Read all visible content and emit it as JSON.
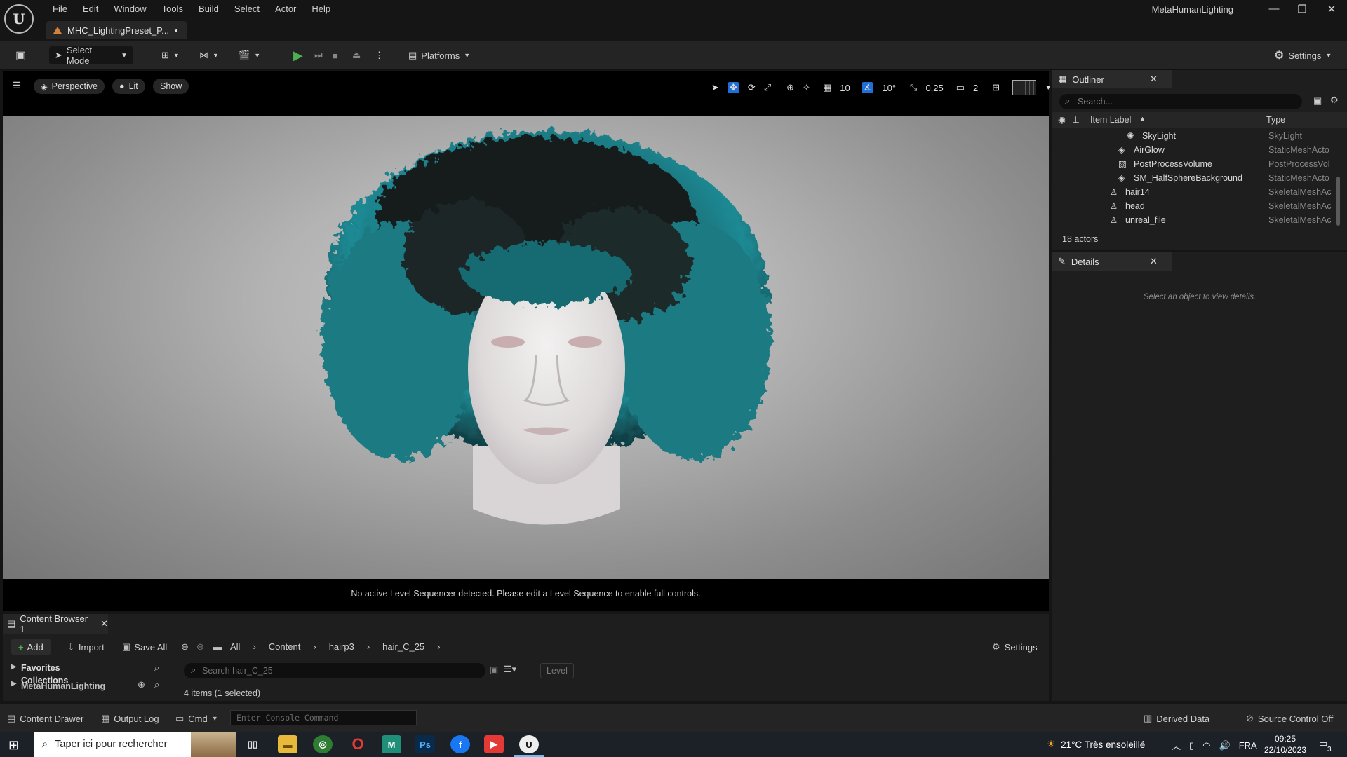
{
  "menu": {
    "items": [
      "File",
      "Edit",
      "Window",
      "Tools",
      "Build",
      "Select",
      "Actor",
      "Help"
    ]
  },
  "window": {
    "project_name": "MetaHumanLighting",
    "doc_tab": "MHC_LightingPreset_P...",
    "modified_marker": "•"
  },
  "toolbar": {
    "select_mode": "Select Mode",
    "platforms": "Platforms",
    "settings": "Settings"
  },
  "viewport": {
    "perspective": "Perspective",
    "lit": "Lit",
    "show": "Show",
    "grid_snap": "10",
    "rotation_snap": "10°",
    "scale_snap": "0,25",
    "camera_speed": "2",
    "sequencer_message": "No active Level Sequencer detected. Please edit a Level Sequence to enable full controls."
  },
  "outliner": {
    "title": "Outliner",
    "search_placeholder": "Search...",
    "col_label": "Item Label",
    "col_type": "Type",
    "rows": [
      {
        "label": "SkyLight",
        "type": "SkyLight"
      },
      {
        "label": "AirGlow",
        "type": "StaticMeshActo"
      },
      {
        "label": "PostProcessVolume",
        "type": "PostProcessVol"
      },
      {
        "label": "SM_HalfSphereBackground",
        "type": "StaticMeshActo"
      },
      {
        "label": "hair14",
        "type": "SkeletalMeshAc"
      },
      {
        "label": "head",
        "type": "SkeletalMeshAc"
      },
      {
        "label": "unreal_file",
        "type": "SkeletalMeshAc"
      }
    ],
    "count": "18 actors"
  },
  "details": {
    "title": "Details",
    "hint": "Select an object to view details."
  },
  "content_browser": {
    "tab": "Content Browser 1",
    "add": "Add",
    "import": "Import",
    "save_all": "Save All",
    "breadcrumbs": [
      "All",
      "Content",
      "hairp3",
      "hair_C_25"
    ],
    "settings": "Settings",
    "favorites": "Favorites",
    "collections": "Collections",
    "project": "MetaHumanLighting",
    "search_placeholder": "Search hair_C_25",
    "level_filter": "Level",
    "item_count": "4 items (1 selected)"
  },
  "statusbar": {
    "content_drawer": "Content Drawer",
    "output_log": "Output Log",
    "cmd": "Cmd",
    "console_placeholder": "Enter Console Command",
    "derived_data": "Derived Data",
    "source_control": "Source Control Off"
  },
  "taskbar": {
    "search_placeholder": "Taper ici pour rechercher",
    "weather": "21°C  Très ensoleillé",
    "language": "FRA",
    "time": "09:25",
    "date": "22/10/2023",
    "notification_count": "3"
  },
  "colors": {
    "accent_blue": "#1f6fd6",
    "play_green": "#4caf50",
    "hair_teal": "#1d7b85",
    "ue_orange": "#d4823a"
  }
}
